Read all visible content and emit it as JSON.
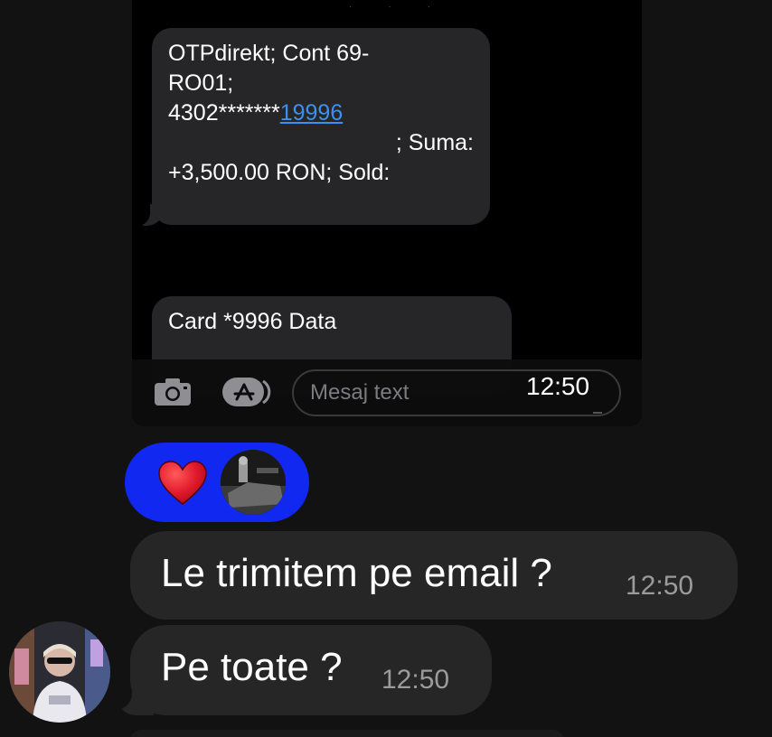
{
  "shared_screenshot": {
    "sms_bank": {
      "line1": "OTPdirekt; Cont 69-",
      "line2": "RO01;",
      "line3_prefix": "4302*******",
      "line3_link": "19996",
      "line4": "; Suma:",
      "line5": "+3,500.00 RON; Sold:"
    },
    "sms_card": {
      "line1": "Card *9996 Data"
    },
    "composer": {
      "placeholder": "Mesaj text",
      "camera_icon": "camera-icon",
      "appstore_icon": "app-store-icon"
    },
    "time": "12:50"
  },
  "reactions": {
    "emoji": "heart-icon",
    "background": "#1028f0"
  },
  "messages": [
    {
      "text": "Le trimitem pe email ?",
      "time": "12:50"
    },
    {
      "text": "Pe toate ?",
      "time": "12:50"
    }
  ],
  "colors": {
    "background": "#121212",
    "bubble": "#262626",
    "link": "#3d8ff0",
    "heart": "#e0192b"
  }
}
